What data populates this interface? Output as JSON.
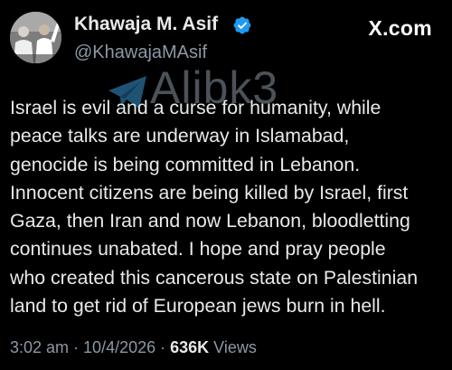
{
  "post": {
    "author": {
      "display_name": "Khawaja M. Asif",
      "handle": "@KhawajaMAsif",
      "verified": true,
      "verified_color": "#1d9bf0"
    },
    "brand": "X.com",
    "watermark": {
      "text": "Alibk3",
      "icon": "telegram-icon"
    },
    "body_lines": [
      "Israel is evil and a curse for humanity, while",
      "peace talks are underway in Islamabad,",
      "genocide is being committed in Lebanon.",
      "Innocent citizens are being killed by Israel, first",
      "Gaza, then Iran and now Lebanon, bloodletting",
      "continues unabated. I hope and pray people",
      "who created this cancerous state on Palestinian",
      "land to get rid of European jews burn in hell."
    ],
    "meta": {
      "time": "3:02 am",
      "separator1": " · ",
      "date": "10/4/2026",
      "separator2": " · ",
      "views_count": "636K",
      "views_label": " Views"
    }
  },
  "colors": {
    "background": "#000000",
    "primary_text": "#e7e9ea",
    "secondary_text": "#8b98a5"
  }
}
